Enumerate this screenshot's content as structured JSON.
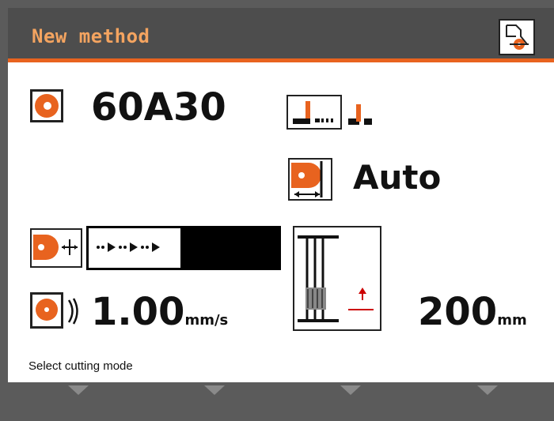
{
  "header": {
    "title": "New method",
    "icon": "method-setup-icon"
  },
  "wheel": {
    "code": "60A30",
    "icon": "cutting-wheel-icon"
  },
  "cut_mode_icons": [
    "cut-type-pulse-icon",
    "cut-type-step-icon"
  ],
  "auto_mode": {
    "label": "Auto",
    "icon": "wheel-width-icon"
  },
  "feed_mode": {
    "icon": "wheel-feed-icon",
    "pattern_icon": "step-feed-pattern-icon"
  },
  "feed_speed": {
    "value": "1.00",
    "unit": "mm/s",
    "icon": "feed-speed-icon"
  },
  "cut_length": {
    "value": "200",
    "unit": "mm",
    "icon": "cut-length-diagram-icon"
  },
  "status": {
    "text": "Select cutting mode"
  },
  "footer": {
    "soft_keys": [
      "softkey-1",
      "softkey-2",
      "softkey-3",
      "softkey-4"
    ]
  },
  "colors": {
    "accent": "#e8631f",
    "title": "#f4a460",
    "frame": "#5b5b5b"
  }
}
